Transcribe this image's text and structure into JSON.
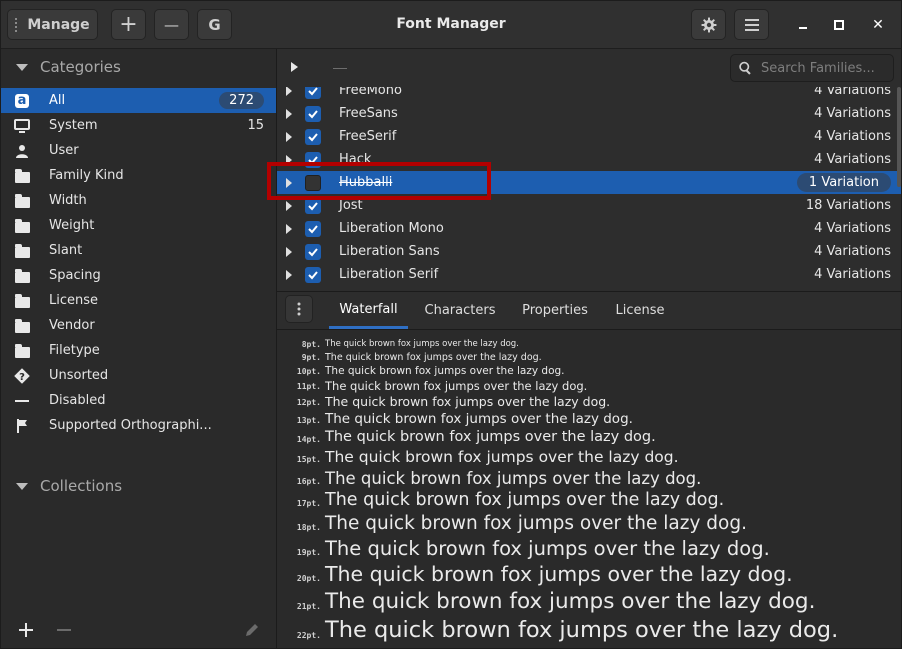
{
  "header": {
    "manage_label": "Manage",
    "add_label": "+",
    "remove_label": "—",
    "google_label": "G",
    "title": "Font Manager",
    "close_label": "✕"
  },
  "sidebar": {
    "categories_label": "Categories",
    "collections_label": "Collections",
    "items": [
      {
        "label": "All",
        "count": "272",
        "icon": "font-icon"
      },
      {
        "label": "System",
        "count": "15",
        "icon": "monitor-icon"
      },
      {
        "label": "User",
        "icon": "user-icon"
      },
      {
        "label": "Family Kind",
        "icon": "folder-icon"
      },
      {
        "label": "Width",
        "icon": "folder-icon"
      },
      {
        "label": "Weight",
        "icon": "folder-icon"
      },
      {
        "label": "Slant",
        "icon": "folder-icon"
      },
      {
        "label": "Spacing",
        "icon": "folder-icon"
      },
      {
        "label": "License",
        "icon": "folder-icon"
      },
      {
        "label": "Vendor",
        "icon": "folder-icon"
      },
      {
        "label": "Filetype",
        "icon": "folder-icon"
      },
      {
        "label": "Unsorted",
        "icon": "question-icon"
      },
      {
        "label": "Disabled",
        "icon": "dash-icon"
      },
      {
        "label": "Supported Orthographi...",
        "icon": "flag-icon"
      }
    ]
  },
  "search": {
    "placeholder": "Search Families..."
  },
  "fonts": [
    {
      "name": "FreeMono",
      "variations": "4 Variations",
      "checked": true
    },
    {
      "name": "FreeSans",
      "variations": "4 Variations",
      "checked": true
    },
    {
      "name": "FreeSerif",
      "variations": "4 Variations",
      "checked": true
    },
    {
      "name": "Hack",
      "variations": "4 Variations",
      "checked": true
    },
    {
      "name": "Hubballi",
      "variations": "1 Variation",
      "checked": false
    },
    {
      "name": "Jost",
      "variations": "18 Variations",
      "checked": true
    },
    {
      "name": "Liberation Mono",
      "variations": "4 Variations",
      "checked": true
    },
    {
      "name": "Liberation Sans",
      "variations": "4 Variations",
      "checked": true
    },
    {
      "name": "Liberation Serif",
      "variations": "4 Variations",
      "checked": true
    }
  ],
  "tabs": [
    "Waterfall",
    "Characters",
    "Properties",
    "License"
  ],
  "preview": {
    "sample": "The quick brown fox jumps over the lazy dog.",
    "sizes": [
      "8pt.",
      "9pt.",
      "10pt.",
      "11pt.",
      "12pt.",
      "13pt.",
      "14pt.",
      "15pt.",
      "16pt.",
      "17pt.",
      "18pt.",
      "19pt.",
      "20pt.",
      "21pt.",
      "22pt."
    ]
  },
  "colors": {
    "accent": "#1d5eb0",
    "highlight": "#b30000"
  }
}
